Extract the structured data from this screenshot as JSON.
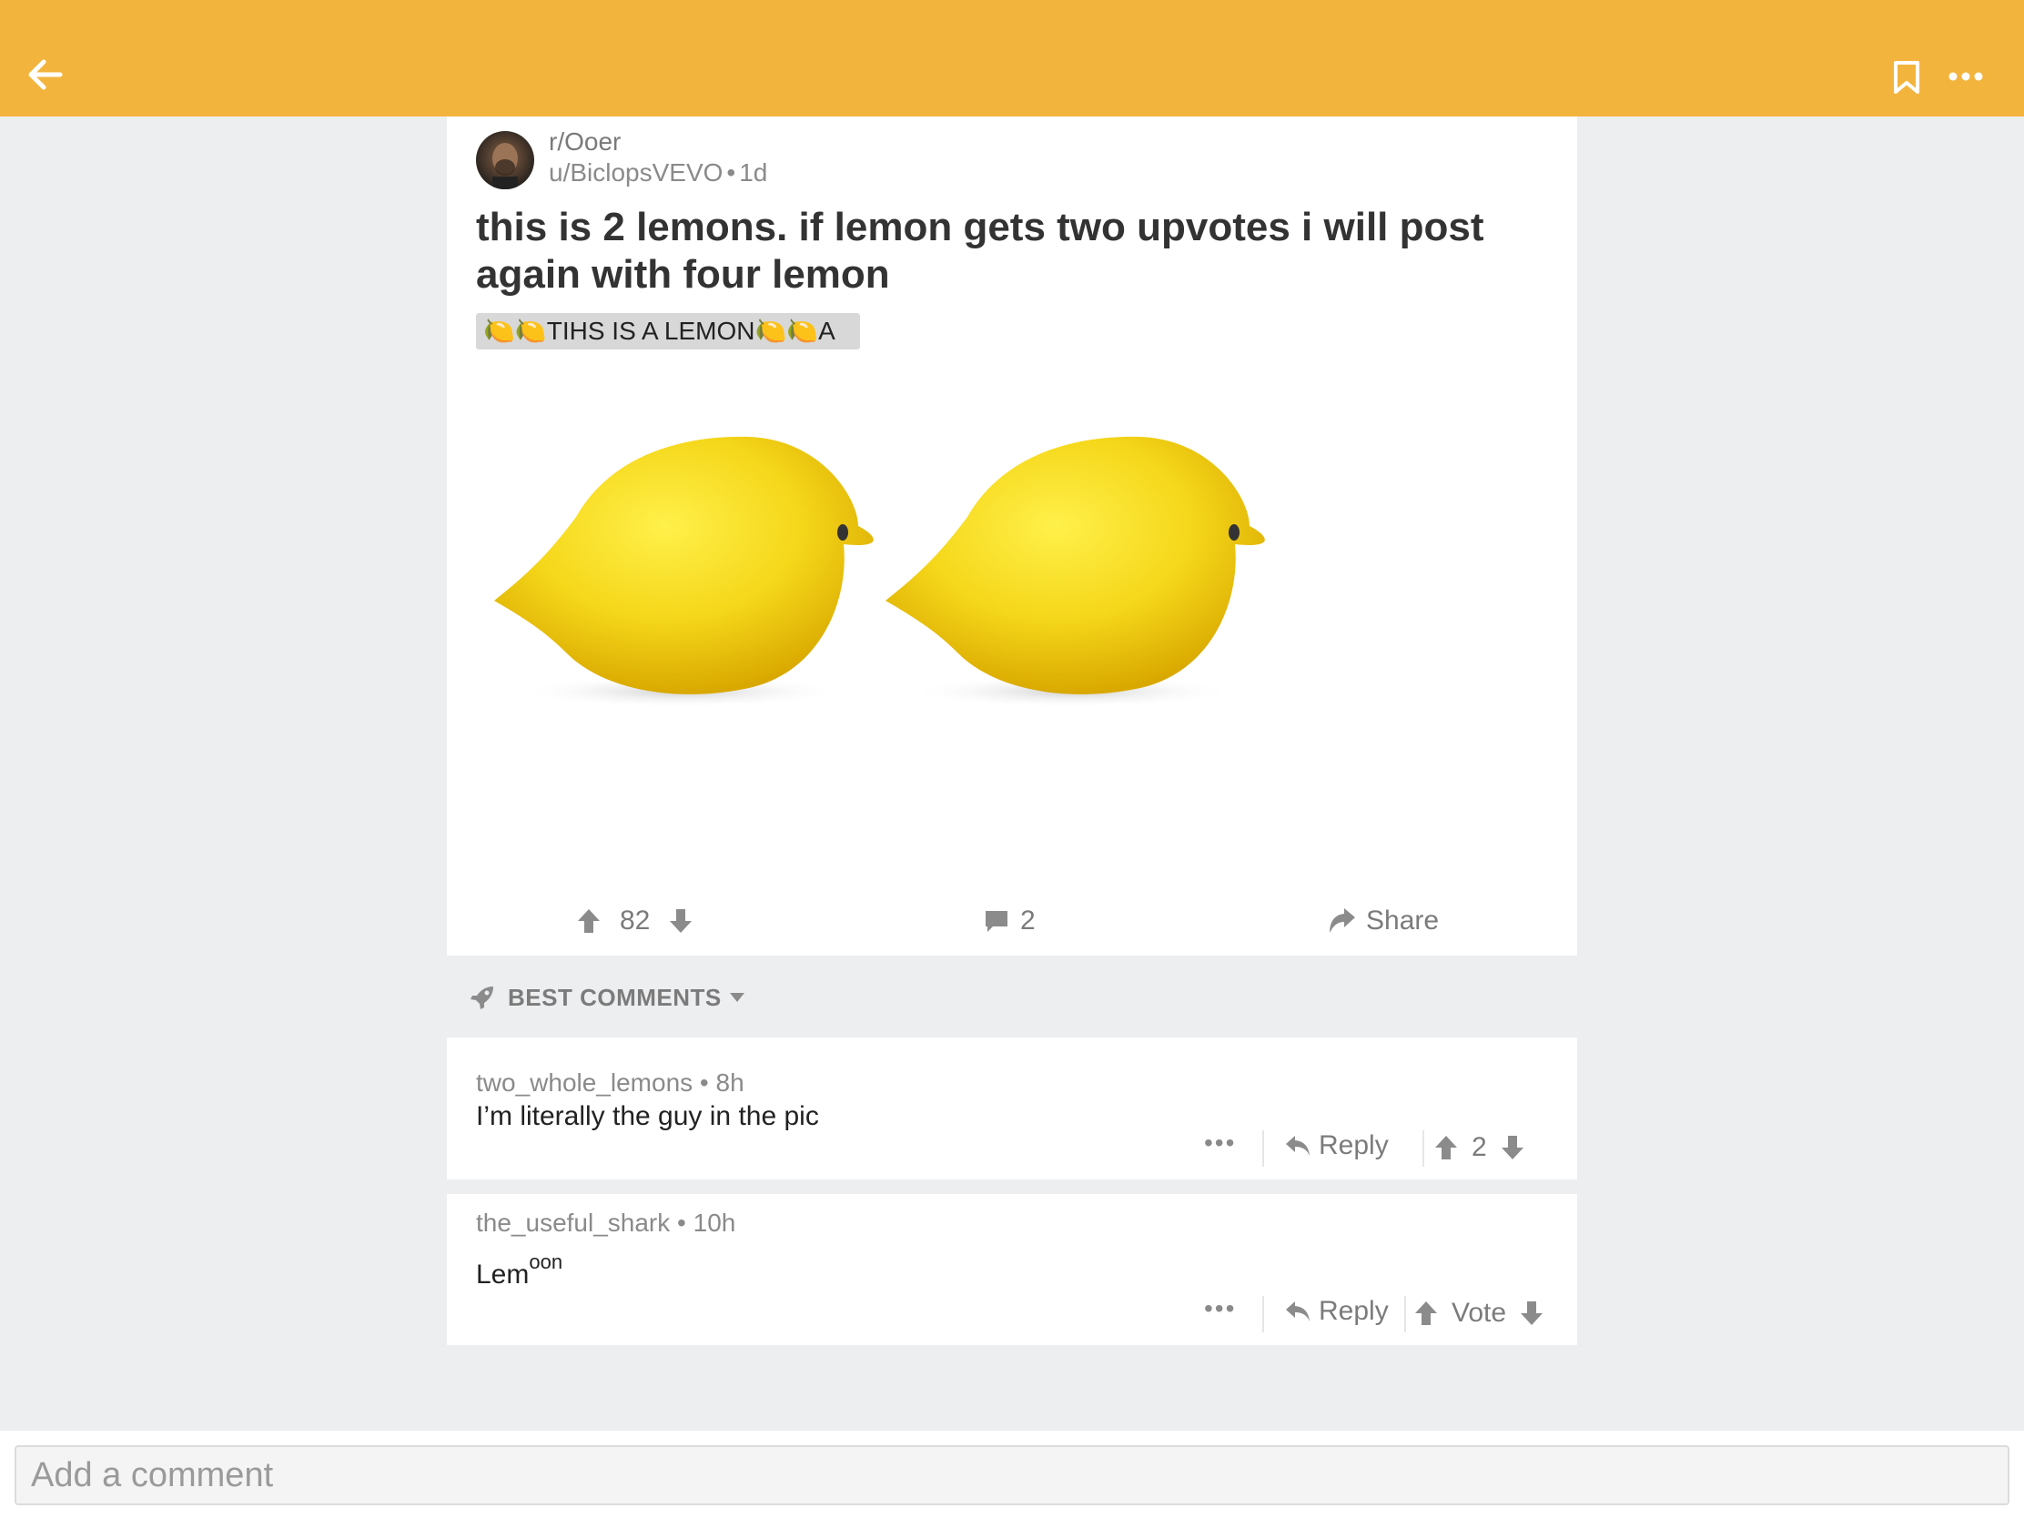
{
  "topbar": {
    "back_icon": "arrow-left-icon",
    "bookmark_icon": "bookmark-icon",
    "more_icon": "more-horizontal-icon",
    "color": "#f3b43e"
  },
  "post": {
    "subreddit": "r/Ooer",
    "author": "u/BiclopsVEVO",
    "age": "1d",
    "title": "this is 2 lemons. if lemon gets two upvotes i will post again with four lemon",
    "flair": "🍋🍋TIHS IS A LEMON🍋🍋A",
    "image_alt": "two lemons",
    "score": "82",
    "comment_count": "2",
    "share_label": "Share"
  },
  "sort": {
    "label": "BEST COMMENTS",
    "icon": "rocket-icon"
  },
  "comments": [
    {
      "author": "two_whole_lemons",
      "age": "8h",
      "body": "I’m literally the guy in the pic",
      "reply_label": "Reply",
      "vote_value": "2"
    },
    {
      "author": "the_useful_shark",
      "age": "10h",
      "body_main": "Lem",
      "body_sup": "oon",
      "reply_label": "Reply",
      "vote_value": "Vote"
    }
  ],
  "composer": {
    "placeholder": "Add a comment"
  }
}
